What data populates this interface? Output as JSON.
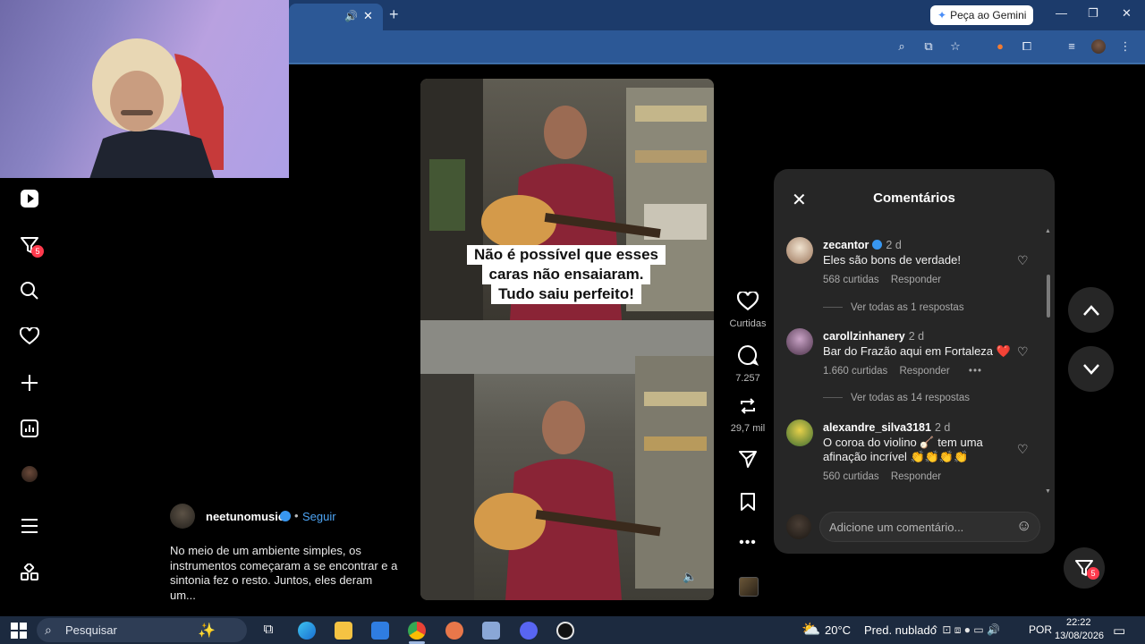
{
  "browser": {
    "tab_speaker": "🔊",
    "tab_close": "✕",
    "new_tab": "+",
    "gemini_label": "Peça ao Gemini",
    "window": {
      "minimize": "—",
      "restore": "❐",
      "close": "✕"
    }
  },
  "sidebar": {
    "notification_count": "5"
  },
  "video": {
    "overlay_lines": [
      "Não é possível que esses",
      "caras não ensaiaram.",
      "Tudo saiu perfeito!"
    ]
  },
  "actions": {
    "likes_label": "Curtidas",
    "comments_count": "7.257",
    "reposts_count": "29,7 mil"
  },
  "post": {
    "author": "neetunomusic",
    "separator": "•",
    "follow_label": "Seguir",
    "caption": "No meio de um ambiente simples, os instrumentos começaram a se encontrar e a sintonia fez o resto. Juntos, eles deram um..."
  },
  "comments_panel": {
    "title": "Comentários",
    "items": [
      {
        "user": "zecantor",
        "verified": true,
        "time": "2 d",
        "text": "Eles são bons de verdade!",
        "likes": "568 curtidas",
        "reply": "Responder",
        "view_replies": "Ver todas as 1 respostas"
      },
      {
        "user": "carollzinhanery",
        "verified": false,
        "time": "2 d",
        "text": "Bar do Frazão aqui em Fortaleza ❤️",
        "likes": "1.660 curtidas",
        "reply": "Responder",
        "more": "•••",
        "view_replies": "Ver todas as 14 respostas"
      },
      {
        "user": "alexandre_silva3181",
        "verified": false,
        "time": "2 d",
        "text": "O coroa do violino 🪕 tem uma afinação incrível 👏👏👏👏",
        "likes": "560 curtidas",
        "reply": "Responder"
      }
    ],
    "input_placeholder": "Adicione um comentário..."
  },
  "floating": {
    "notification_count": "5"
  },
  "taskbar": {
    "search_label": "Pesquisar",
    "weather_temp": "20°C",
    "weather_desc": "Pred. nublado",
    "language": "POR",
    "time": "22:22",
    "date": "13/08/2026"
  },
  "colors": {
    "accent_blue": "#4ea5f5",
    "badge_red": "#ff3a4d",
    "panel_bg": "#262626",
    "chrome_blue": "#2c5896"
  }
}
